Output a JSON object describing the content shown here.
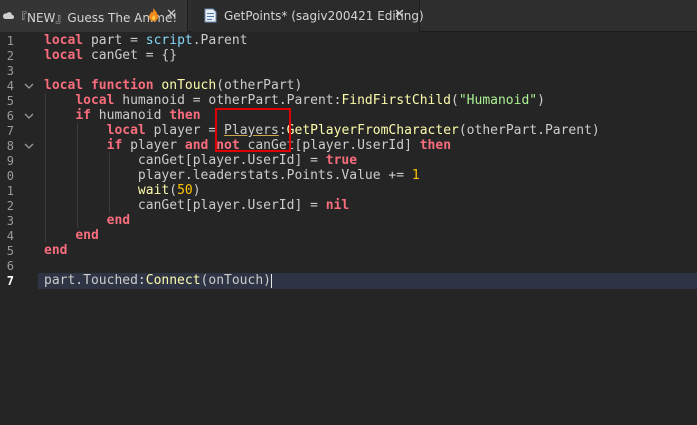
{
  "tabs": [
    {
      "label": "『NEW』Guess The Anime!",
      "icon": "cloud-icon",
      "badge_icon": "fire-icon",
      "close": "✕",
      "active": false
    },
    {
      "label": "GetPoints* (sagiv200421 Editing)",
      "icon": "script-icon",
      "close": "✕",
      "active": true
    }
  ],
  "editor": {
    "current_line": 17,
    "lines": [
      {
        "n": "1"
      },
      {
        "n": "2"
      },
      {
        "n": "3"
      },
      {
        "n": "4"
      },
      {
        "n": "5"
      },
      {
        "n": "6"
      },
      {
        "n": "7"
      },
      {
        "n": "8"
      },
      {
        "n": "9"
      },
      {
        "n": "0"
      },
      {
        "n": "1"
      },
      {
        "n": "2"
      },
      {
        "n": "3"
      },
      {
        "n": "4"
      },
      {
        "n": "5"
      },
      {
        "n": "6"
      },
      {
        "n": "7"
      }
    ],
    "code": {
      "l1": {
        "kw": "local",
        "a": " part = ",
        "b": "script",
        "c": ".Parent"
      },
      "l2": {
        "kw": "local",
        "a": " canGet = {}"
      },
      "l4": {
        "kw1": "local",
        "kw2": "function",
        "fn": "onTouch",
        "a": "(otherPart)"
      },
      "l5": {
        "kw": "local",
        "a": " humanoid = otherPart.Parent:",
        "fn": "FindFirstChild",
        "b": "(",
        "str": "\"Humanoid\"",
        "c": ")"
      },
      "l6": {
        "kw1": "if",
        "a": " humanoid ",
        "kw2": "then"
      },
      "l7": {
        "kw": "local",
        "a": " player = ",
        "svc": "Players",
        "b": ":",
        "fn": "GetPlayerFromCharacter",
        "c": "(otherPart.Parent)"
      },
      "l8": {
        "kw1": "if",
        "a": " player ",
        "kw2": "and",
        "kw3": "not",
        "b": " canGet[player.UserId] ",
        "kw4": "then"
      },
      "l9": {
        "a": "canGet[player.UserId] = ",
        "kw": "true"
      },
      "l10": {
        "a": "player.leaderstats.Points.Value += ",
        "num": "1"
      },
      "l11": {
        "fn": "wait",
        "a": "(",
        "num": "50",
        "b": ")"
      },
      "l12": {
        "a": "canGet[player.UserId] = ",
        "kw": "nil"
      },
      "l13": {
        "kw": "end"
      },
      "l14": {
        "kw": "end"
      },
      "l15": {
        "kw": "end"
      },
      "l17": {
        "a": "part.Touched:",
        "fn": "Connect",
        "b": "(onTouch)"
      }
    }
  },
  "colors": {
    "keyword": "#f86d7c",
    "builtin": "#84d6f7",
    "function": "#fdfbac",
    "string": "#adf195",
    "number": "#ffc600",
    "highlight_box": "#e00000"
  }
}
